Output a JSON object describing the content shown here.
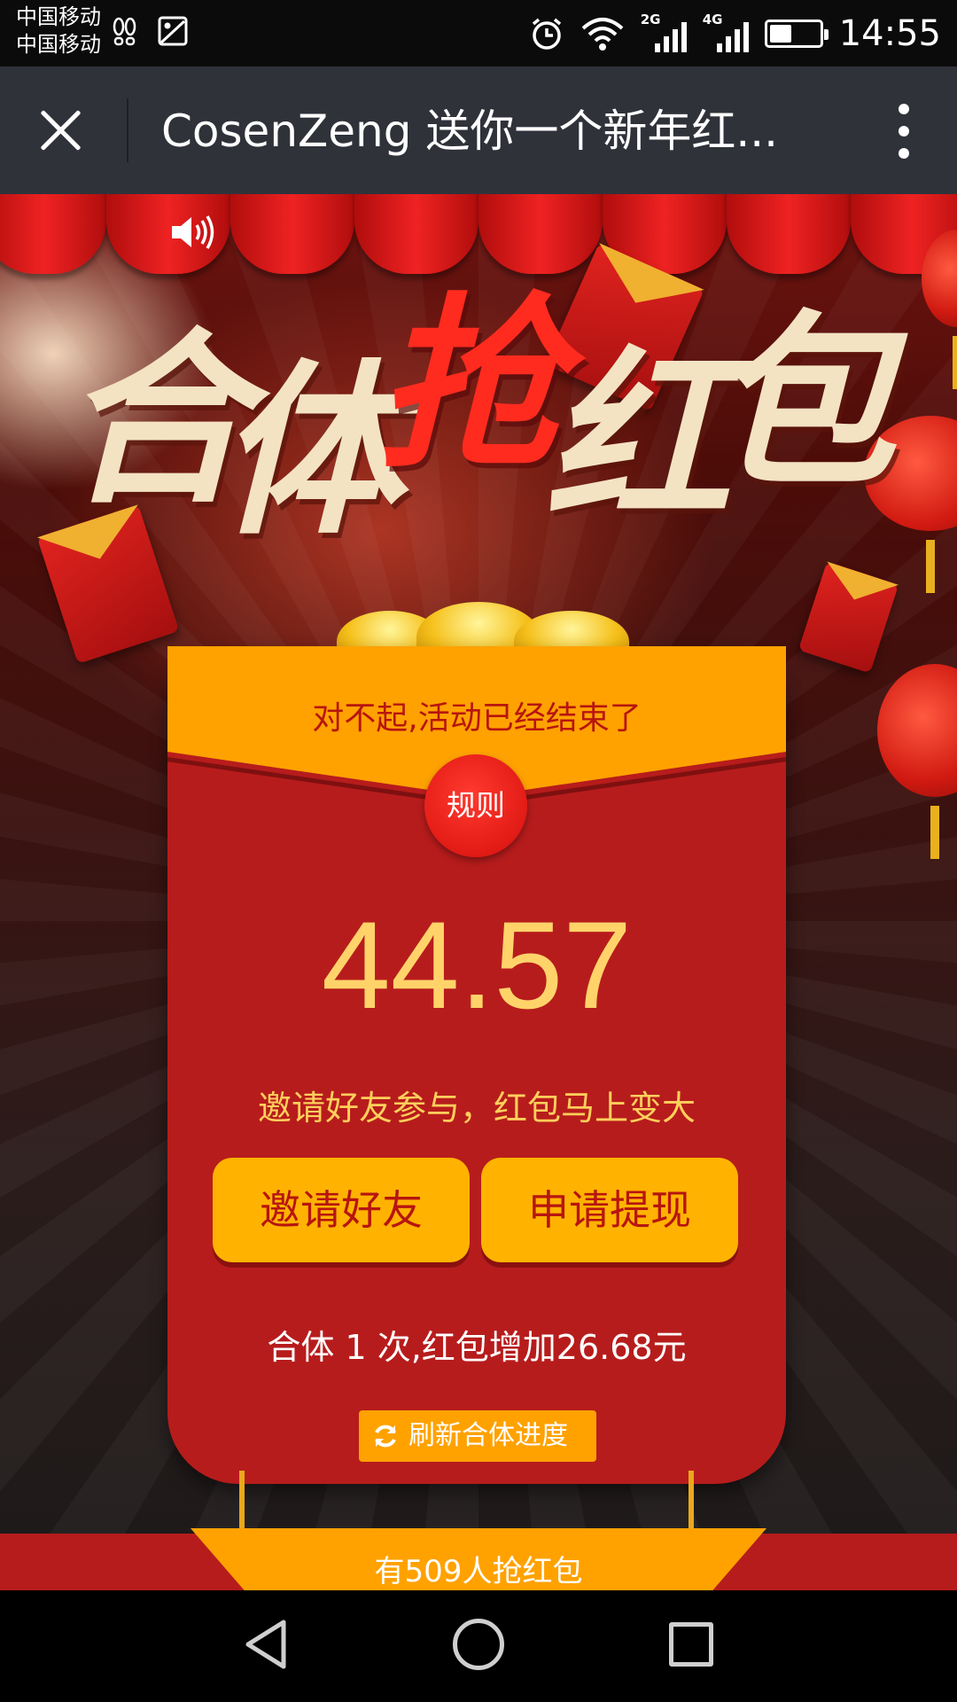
{
  "status_bar": {
    "carrier_1": "中国移动",
    "carrier_2": "中国移动",
    "signal_1_label": "2G",
    "signal_2_label": "4G",
    "time": "14:55",
    "battery_level": 0.45,
    "icons": [
      "footprint-icon",
      "image-icon",
      "alarm-icon",
      "wifi-icon",
      "signal-2g-icon",
      "signal-4g-icon",
      "battery-icon"
    ]
  },
  "top_bar": {
    "title": "CosenZeng 送你一个新年红...",
    "icons": [
      "close-icon",
      "more-vertical-icon"
    ]
  },
  "headline": {
    "chars": [
      "合",
      "体",
      "抢",
      "红",
      "包"
    ]
  },
  "card": {
    "notice": "对不起,活动已经结束了",
    "rules_label": "规则",
    "amount": "44.57",
    "amount_hint": "邀请好友参与，红包马上变大",
    "invite_label": "邀请好友",
    "withdraw_label": "申请提现",
    "combine_text": "合体 1 次,红包增加26.68元",
    "refresh_label": "刷新合体进度"
  },
  "bottom": {
    "participants_text": "有509人抢红包"
  },
  "colors": {
    "envelope_red": "#b71c1c",
    "gold": "#ffa200",
    "button_yellow": "#ffb300",
    "amount_gold": "#ffd36a",
    "headline_cream": "#f3e3c3",
    "headline_red": "#ff2b1e"
  }
}
